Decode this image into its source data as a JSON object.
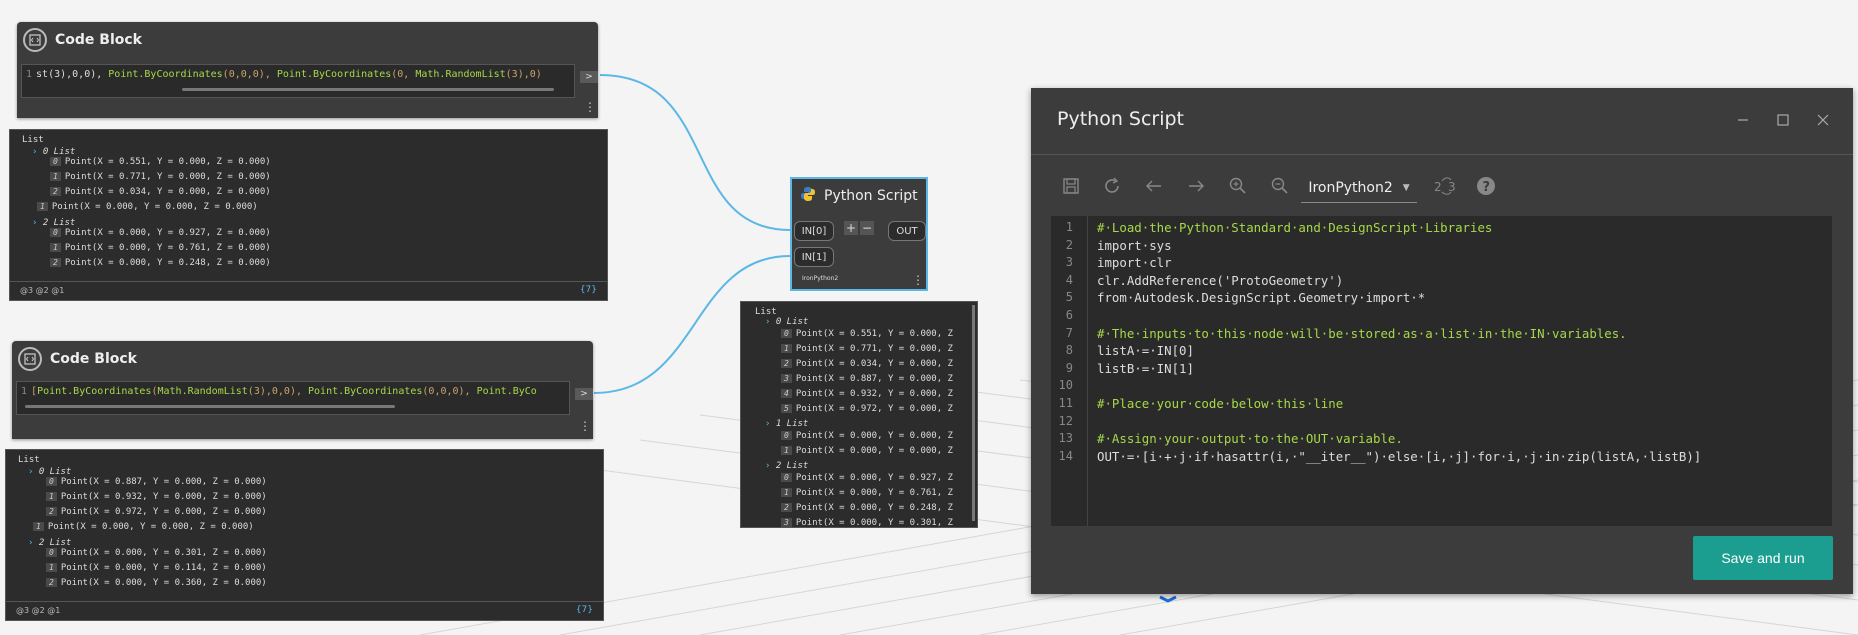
{
  "code_block_1": {
    "title": "Code Block",
    "line_number": "1",
    "code_parts": [
      "st(3),0,0), ",
      "Point.ByCoordinates",
      "(0,0,0), ",
      "Point.ByCoordinates",
      "(0, ",
      "Math.RandomList",
      "(3),0)"
    ],
    "out_port": ">",
    "menu": "⋮"
  },
  "code_block_2": {
    "title": "Code Block",
    "line_number": "1",
    "code_parts": [
      "[",
      "Point.ByCoordinates",
      "(",
      "Math.RandomList",
      "(3),0,0), ",
      "Point.ByCoordinates",
      "(0,0,0), ",
      "Point.ByCo"
    ],
    "out_port": ">",
    "menu": "⋮"
  },
  "preview_1": {
    "header": "List",
    "group0_label": "0 List",
    "group0": [
      {
        "index": "0",
        "text": "Point(X = 0.551, Y = 0.000, Z = 0.000)"
      },
      {
        "index": "1",
        "text": "Point(X = 0.771, Y = 0.000, Z = 0.000)"
      },
      {
        "index": "2",
        "text": "Point(X = 0.034, Y = 0.000, Z = 0.000)"
      }
    ],
    "item1": {
      "index": "1",
      "text": "Point(X = 0.000, Y = 0.000, Z = 0.000)"
    },
    "group2_label": "2 List",
    "group2": [
      {
        "index": "0",
        "text": "Point(X = 0.000, Y = 0.927, Z = 0.000)"
      },
      {
        "index": "1",
        "text": "Point(X = 0.000, Y = 0.761, Z = 0.000)"
      },
      {
        "index": "2",
        "text": "Point(X = 0.000, Y = 0.248, Z = 0.000)"
      }
    ],
    "levels": "@3 @2 @1",
    "count": "{7}"
  },
  "preview_2": {
    "header": "List",
    "group0_label": "0 List",
    "group0": [
      {
        "index": "0",
        "text": "Point(X = 0.887, Y = 0.000, Z = 0.000)"
      },
      {
        "index": "1",
        "text": "Point(X = 0.932, Y = 0.000, Z = 0.000)"
      },
      {
        "index": "2",
        "text": "Point(X = 0.972, Y = 0.000, Z = 0.000)"
      }
    ],
    "item1": {
      "index": "1",
      "text": "Point(X = 0.000, Y = 0.000, Z = 0.000)"
    },
    "group2_label": "2 List",
    "group2": [
      {
        "index": "0",
        "text": "Point(X = 0.000, Y = 0.301, Z = 0.000)"
      },
      {
        "index": "1",
        "text": "Point(X = 0.000, Y = 0.114, Z = 0.000)"
      },
      {
        "index": "2",
        "text": "Point(X = 0.000, Y = 0.360, Z = 0.000)"
      }
    ],
    "levels": "@3 @2 @1",
    "count": "{7}"
  },
  "python_node": {
    "title": "Python Script",
    "in0": "IN[0]",
    "in1": "IN[1]",
    "add": "+",
    "remove": "−",
    "out": "OUT",
    "engine": "IronPython2",
    "menu": "⋮"
  },
  "python_preview": {
    "header": "List",
    "group0_label": "0 List",
    "group0": [
      {
        "index": "0",
        "text": "Point(X = 0.551, Y = 0.000, Z"
      },
      {
        "index": "1",
        "text": "Point(X = 0.771, Y = 0.000, Z"
      },
      {
        "index": "2",
        "text": "Point(X = 0.034, Y = 0.000, Z"
      },
      {
        "index": "3",
        "text": "Point(X = 0.887, Y = 0.000, Z"
      },
      {
        "index": "4",
        "text": "Point(X = 0.932, Y = 0.000, Z"
      },
      {
        "index": "5",
        "text": "Point(X = 0.972, Y = 0.000, Z"
      }
    ],
    "group1_label": "1 List",
    "group1": [
      {
        "index": "0",
        "text": "Point(X = 0.000, Y = 0.000, Z"
      },
      {
        "index": "1",
        "text": "Point(X = 0.000, Y = 0.000, Z"
      }
    ],
    "group2_label": "2 List",
    "group2": [
      {
        "index": "0",
        "text": "Point(X = 0.000, Y = 0.927, Z"
      },
      {
        "index": "1",
        "text": "Point(X = 0.000, Y = 0.761, Z"
      },
      {
        "index": "2",
        "text": "Point(X = 0.000, Y = 0.248, Z"
      },
      {
        "index": "3",
        "text": "Point(X = 0.000, Y = 0.301, Z"
      }
    ]
  },
  "editor": {
    "title": "Python Script",
    "engine": "IronPython2",
    "save_run": "Save and run",
    "line_numbers": [
      "1",
      "2",
      "3",
      "4",
      "5",
      "6",
      "7",
      "8",
      "9",
      "10",
      "11",
      "12",
      "13",
      "14"
    ],
    "lines": [
      "#·Load·the·Python·Standard·and·DesignScript·Libraries",
      "import·sys",
      "import·clr",
      "clr.AddReference('ProtoGeometry')",
      "from·Autodesk.DesignScript.Geometry·import·*",
      "",
      "#·The·inputs·to·this·node·will·be·stored·as·a·list·in·the·IN·variables.",
      "listA·=·IN[0]",
      "listB·=·IN[1]",
      "",
      "#·Place·your·code·below·this·line",
      "",
      "#·Assign·your·output·to·the·OUT·variable.",
      "OUT·=·[i·+·j·if·hasattr(i,·\"__iter__\")·else·[i,·j]·for·i,·j·in·zip(listA,·listB)]"
    ]
  },
  "colors": {
    "wire": "#5ab7e6",
    "node_bg": "#3c3c3c",
    "accent": "#1b9e8f",
    "selection": "#5ab7e6"
  }
}
